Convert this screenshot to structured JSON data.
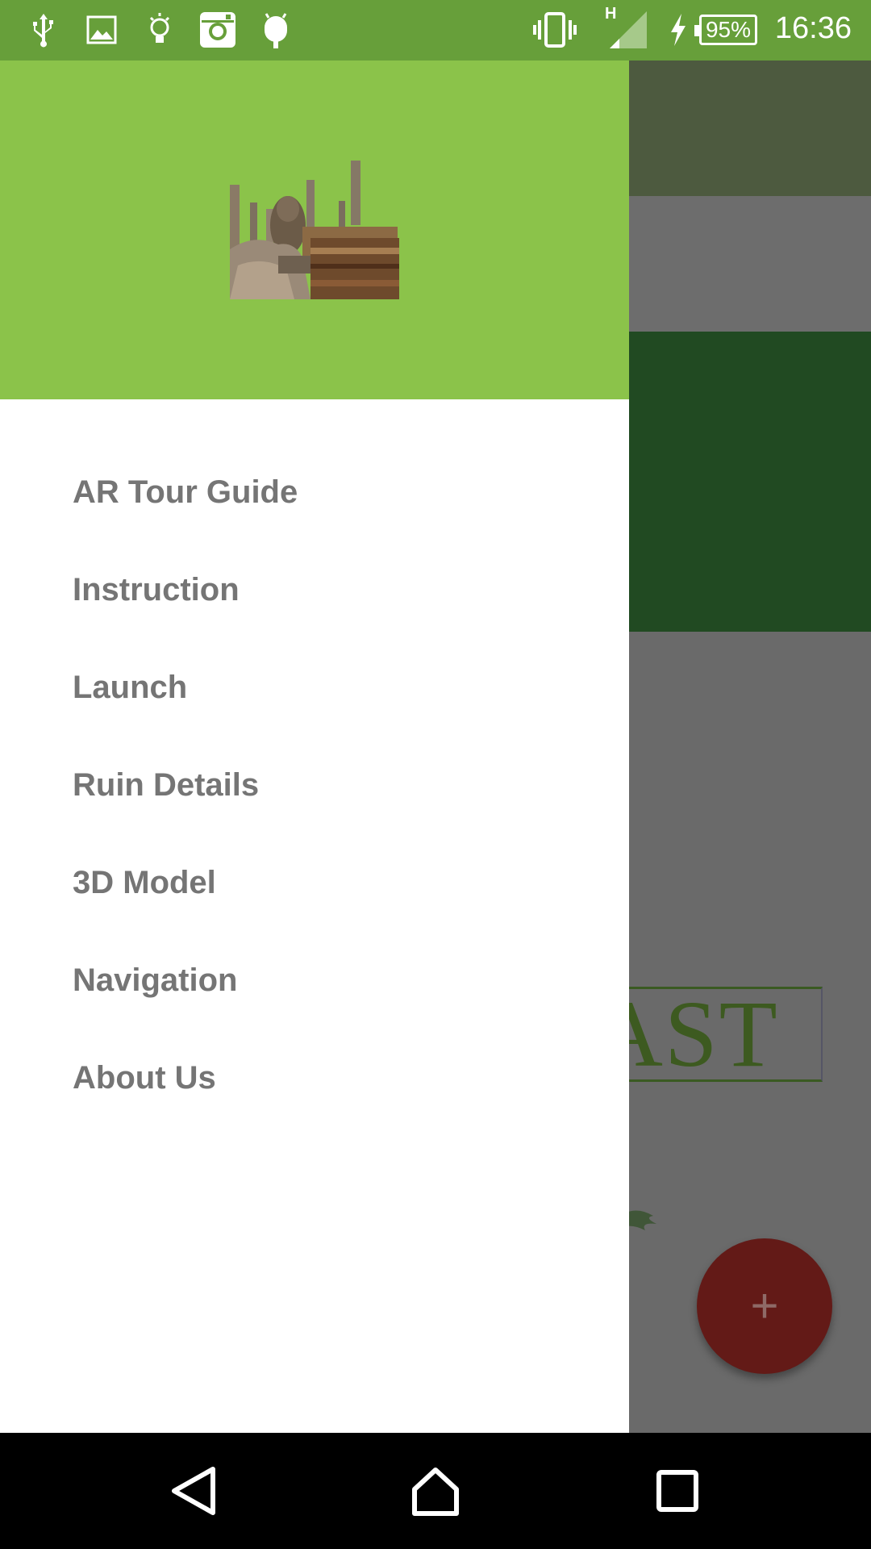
{
  "status_bar": {
    "time": "16:36",
    "battery_percent": "95%",
    "network_type": "H",
    "left_icons": [
      "usb-icon",
      "image-icon",
      "bulb-icon",
      "instagram-icon",
      "android-icon"
    ],
    "right_icons": [
      "vibrate-icon",
      "signal-icon",
      "charging-icon"
    ]
  },
  "drawer": {
    "header_image": "ancient-ruins-photo",
    "menu_items": [
      {
        "label": "AR Tour Guide"
      },
      {
        "label": "Instruction"
      },
      {
        "label": "Launch"
      },
      {
        "label": "Ruin Details"
      },
      {
        "label": "3D Model"
      },
      {
        "label": "Navigation"
      },
      {
        "label": "About Us"
      }
    ]
  },
  "background_app": {
    "logo_text_fragment": "PAST",
    "fab_label": "+"
  },
  "nav_bar": {
    "buttons": [
      "back-icon",
      "home-icon",
      "recents-icon"
    ]
  },
  "colors": {
    "status_bar": "#679F3A",
    "drawer_header": "#8BC34A",
    "menu_text": "#757575",
    "fab": "#631A17"
  }
}
